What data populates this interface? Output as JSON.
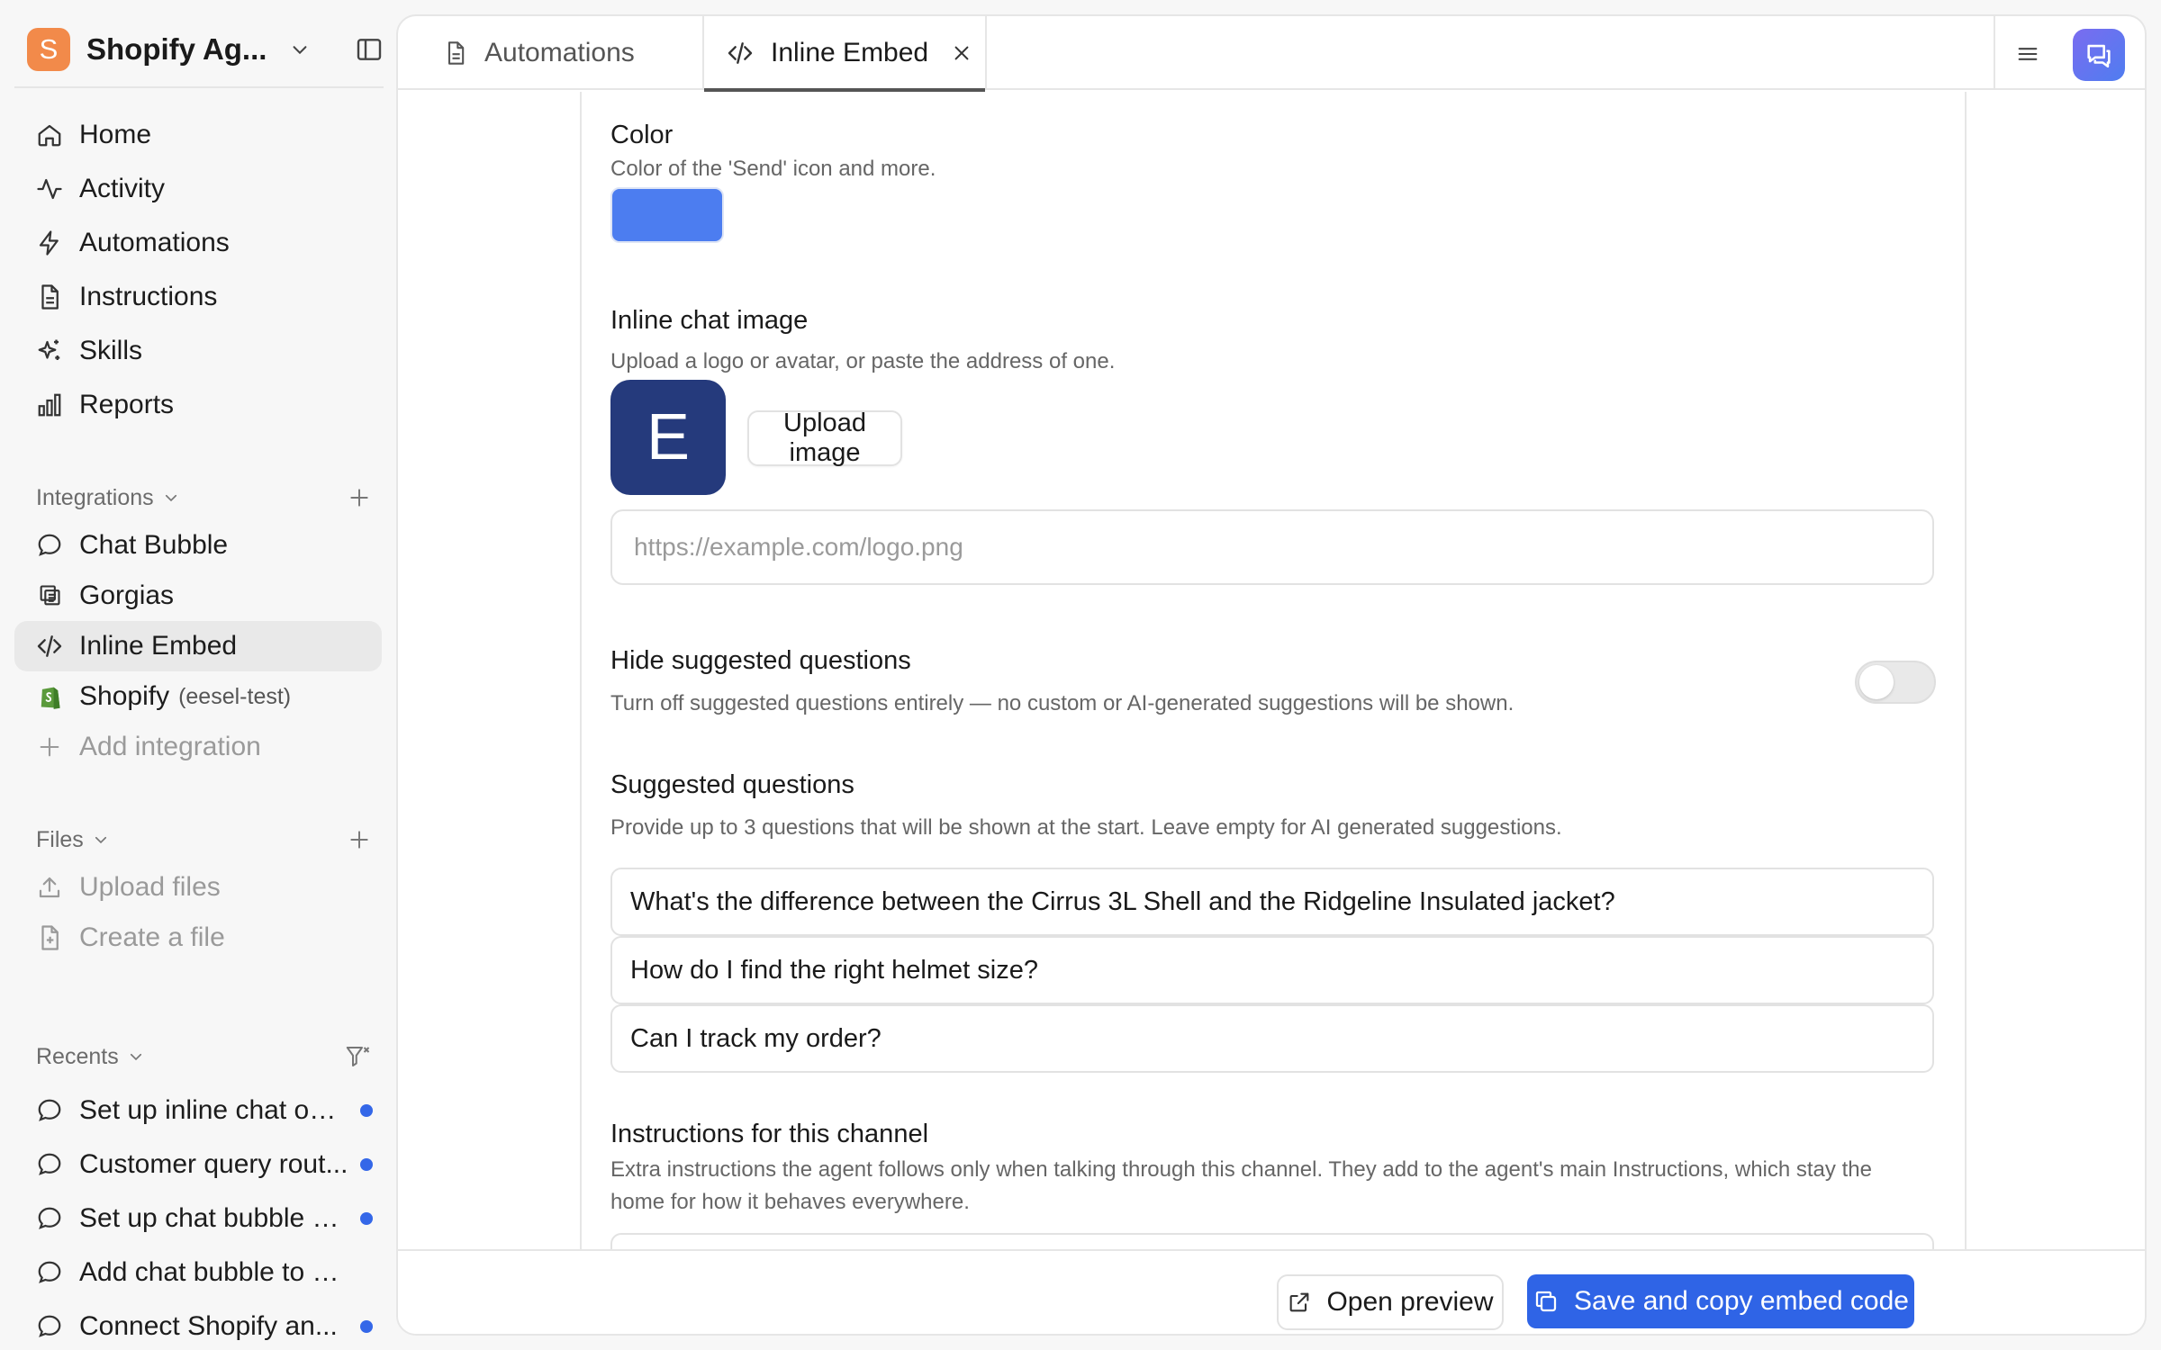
{
  "workspace": {
    "initial": "S",
    "name": "Shopify Ag..."
  },
  "nav": [
    {
      "label": "Home",
      "icon": "home-icon"
    },
    {
      "label": "Activity",
      "icon": "activity-icon"
    },
    {
      "label": "Automations",
      "icon": "bolt-icon"
    },
    {
      "label": "Instructions",
      "icon": "document-icon"
    },
    {
      "label": "Skills",
      "icon": "sparkles-icon"
    },
    {
      "label": "Reports",
      "icon": "bar-chart-icon"
    }
  ],
  "integrations": {
    "title": "Integrations",
    "items": [
      {
        "label": "Chat Bubble",
        "icon": "chat-bubble-icon"
      },
      {
        "label": "Gorgias",
        "icon": "gorgias-icon"
      },
      {
        "label": "Inline Embed",
        "icon": "code-icon"
      },
      {
        "label": "Shopify",
        "sub": "(eesel-test)",
        "icon": "shopify-icon"
      }
    ],
    "add_label": "Add integration"
  },
  "files": {
    "title": "Files",
    "upload_label": "Upload files",
    "create_label": "Create a file"
  },
  "recents": {
    "title": "Recents",
    "items": [
      {
        "label": "Set up inline chat on ..."
      },
      {
        "label": "Customer query rout..."
      },
      {
        "label": "Set up chat bubble h..."
      },
      {
        "label": "Add chat bubble to Sh..."
      },
      {
        "label": "Connect Shopify an..."
      }
    ]
  },
  "tabs": [
    {
      "label": "Automations"
    },
    {
      "label": "Inline Embed"
    }
  ],
  "form": {
    "color": {
      "title": "Color",
      "description": "Color of the 'Send' icon and more.",
      "value": "#4c7df0"
    },
    "image": {
      "title": "Inline chat image",
      "description": "Upload a logo or avatar, or paste the address of one.",
      "avatar_letter": "E",
      "upload_label": "Upload image",
      "url_placeholder": "https://example.com/logo.png"
    },
    "hide_suggested": {
      "title": "Hide suggested questions",
      "description": "Turn off suggested questions entirely — no custom or AI-generated suggestions will be shown.",
      "enabled": false
    },
    "suggested": {
      "title": "Suggested questions",
      "description": "Provide up to 3 questions that will be shown at the start. Leave empty for AI generated suggestions.",
      "questions": [
        "What's the difference between the Cirrus 3L Shell and the Ridgeline Insulated jacket?",
        "How do I find the right helmet size?",
        "Can I track my order?"
      ]
    },
    "channel_instructions": {
      "title": "Instructions for this channel",
      "description_line1": "Extra instructions the agent follows only when talking through this channel. They add to the agent's main Instructions, which stay the",
      "description_line2": "home for how it behaves everywhere."
    }
  },
  "footer": {
    "preview_label": "Open preview",
    "save_label": "Save and copy embed code"
  },
  "colors": {
    "accent": "#2f64e6",
    "workspace_logo": "#f28a4a",
    "avatar_bg": "#253a7c",
    "unread_dot": "#3467e8"
  }
}
